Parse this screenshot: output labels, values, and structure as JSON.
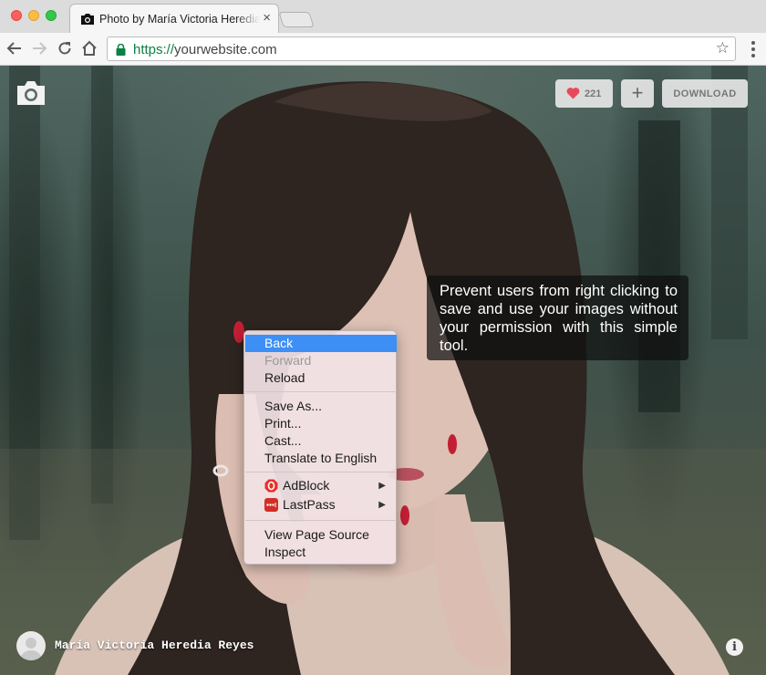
{
  "browser": {
    "tab_title": "Photo by María Victoria Heredia Reyes",
    "tab_close": "×",
    "url_scheme": "https://",
    "url_host": "yourwebsite.com",
    "star_glyph": "☆"
  },
  "page": {
    "like_count": "221",
    "add_glyph": "+",
    "download_label": "DOWNLOAD",
    "tooltip_text": "Prevent users from right clicking to save and use your images without your permission with this simple tool.",
    "author_name": "María Victoria Heredia Reyes",
    "info_glyph": "i"
  },
  "context_menu": {
    "back": "Back",
    "forward": "Forward",
    "reload": "Reload",
    "save_as": "Save As...",
    "print": "Print...",
    "cast": "Cast...",
    "translate": "Translate to English",
    "adblock": "AdBlock",
    "lastpass": "LastPass",
    "view_source": "View Page Source",
    "inspect": "Inspect",
    "submenu_arrow": "▶"
  },
  "colors": {
    "highlight": "#3d8ff5",
    "heart": "#e8485a",
    "secure_green": "#0b8043"
  }
}
